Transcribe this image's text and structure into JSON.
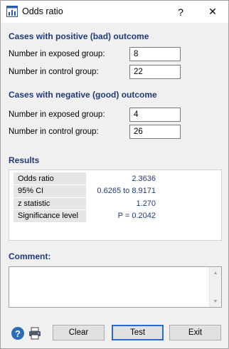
{
  "window": {
    "title": "Odds ratio",
    "help_glyph": "?",
    "close_glyph": "✕"
  },
  "positive": {
    "heading": "Cases with positive (bad) outcome",
    "exposed_label": "Number in exposed group:",
    "exposed_value": "8",
    "control_label": "Number in control group:",
    "control_value": "22"
  },
  "negative": {
    "heading": "Cases with negative (good) outcome",
    "exposed_label": "Number in exposed group:",
    "exposed_value": "4",
    "control_label": "Number in control group:",
    "control_value": "26"
  },
  "results": {
    "heading": "Results",
    "rows": [
      {
        "label": "Odds ratio",
        "value": "2.3636"
      },
      {
        "label": "95% CI",
        "value": "0.6265 to 8.9171"
      },
      {
        "label": "z statistic",
        "value": "1.270"
      },
      {
        "label": "Significance level",
        "value": "P = 0.2042"
      }
    ]
  },
  "comment": {
    "heading": "Comment:",
    "value": ""
  },
  "buttons": {
    "clear": "Clear",
    "test": "Test",
    "exit": "Exit"
  },
  "icons": {
    "help": "help-circle-icon",
    "print": "printer-icon"
  },
  "colors": {
    "heading": "#1f3a7a",
    "default_button_border": "#2a6ad0",
    "help_icon": "#2b6cb8"
  }
}
